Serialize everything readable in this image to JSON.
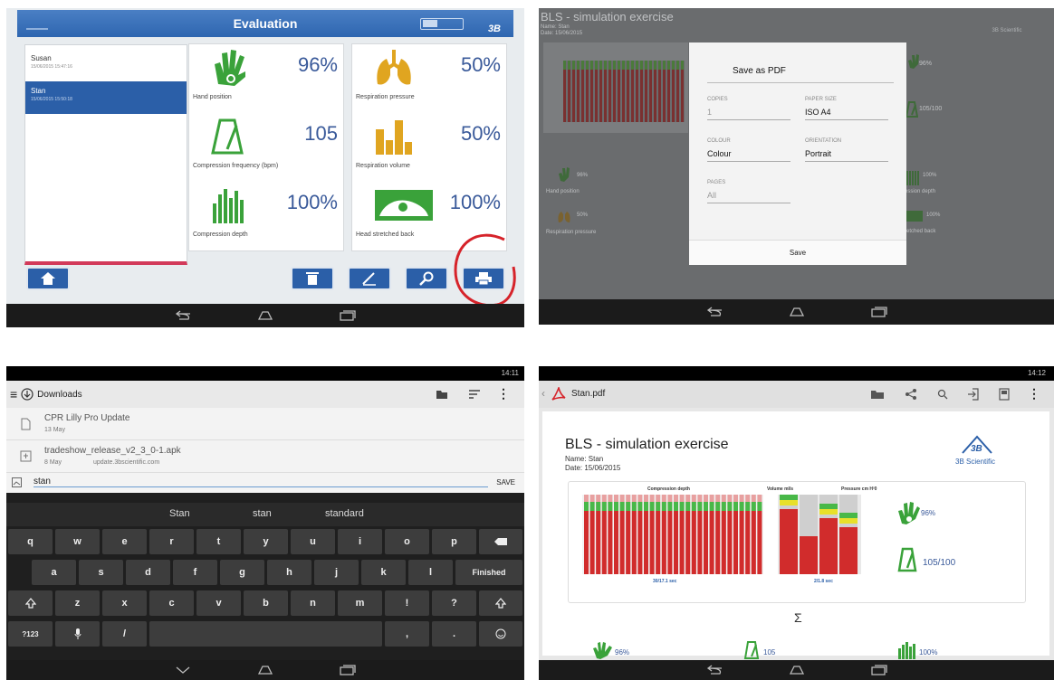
{
  "p1": {
    "title": "Evaluation",
    "names": [
      {
        "name": "Susan",
        "date": "15/06/2015 15:47:16"
      },
      {
        "name": "Stan",
        "date": "15/06/2015 15:50:18"
      }
    ],
    "metrics": [
      {
        "label": "Hand position",
        "value": "96%",
        "icon": "hand-icon"
      },
      {
        "label": "Respiration pressure",
        "value": "50%",
        "icon": "lungs-icon"
      },
      {
        "label": "Compression frequency (bpm)",
        "value": "105",
        "icon": "metronome-icon"
      },
      {
        "label": "Respiration volume",
        "value": "50%",
        "icon": "volume-bars-icon"
      },
      {
        "label": "Compression depth",
        "value": "100%",
        "icon": "depth-bars-icon"
      },
      {
        "label": "Head stretched back",
        "value": "100%",
        "icon": "head-tilt-icon"
      }
    ]
  },
  "p2": {
    "doc_title": "BLS - simulation exercise",
    "doc_name": "Name: Stan",
    "doc_date": "Date: 15/06/2015",
    "printer": "Save as PDF",
    "copies_label": "COPIES",
    "copies": "1",
    "paper_label": "PAPER SIZE",
    "paper": "ISO A4",
    "colour_label": "COLOUR",
    "colour": "Colour",
    "orientation_label": "ORIENTATION",
    "orientation": "Portrait",
    "pages_label": "PAGES",
    "pages": "All",
    "save": "Save",
    "bg_pct_1": "96%",
    "bg_ratio": "105/100",
    "bg_hand": "Hand position",
    "bg_resp": "Respiration pressure",
    "bg_pct_2": "96%",
    "bg_pct_3": "50%",
    "bg_pct_4": "100%",
    "bg_pct_5": "100%",
    "bg_depth": "ession depth",
    "bg_head": "retched back"
  },
  "p3": {
    "time": "14:11",
    "folder": "Downloads",
    "files": [
      {
        "name": "CPR Lilly Pro Update",
        "sub": "13 May"
      },
      {
        "name": "tradeshow_release_v2_3_0-1.apk",
        "sub": "8 May",
        "sub2": "update.3bscientific.com"
      }
    ],
    "filename": "stan",
    "save": "SAVE",
    "suggestions": [
      "Stan",
      "stan",
      "standard"
    ],
    "row1": [
      "q",
      "w",
      "e",
      "r",
      "t",
      "y",
      "u",
      "i",
      "o",
      "p"
    ],
    "row2": [
      "a",
      "s",
      "d",
      "f",
      "g",
      "h",
      "j",
      "k",
      "l"
    ],
    "row3": [
      "z",
      "x",
      "c",
      "v",
      "b",
      "n",
      "m",
      "!",
      "?"
    ],
    "finished": "Finished",
    "sym": "?123",
    "slash": "/",
    "comma": ",",
    "dot": "."
  },
  "p4": {
    "time": "14:12",
    "file": "Stan.pdf",
    "title": "BLS - simulation exercise",
    "name": "Name: Stan",
    "date": "Date: 15/06/2015",
    "brand": "3B Scientific",
    "chart1_title": "Compression depth",
    "chart2_title": "Volume ml/s",
    "chart3_title": "Pressure cm H²0",
    "chart1_footer": "30/17.1 sec",
    "chart2_footer": "2/1.8 sec",
    "hand_pct": "96%",
    "freq": "105/100",
    "sigma": "Σ",
    "bottom": [
      "96%",
      "105",
      "100%"
    ]
  }
}
